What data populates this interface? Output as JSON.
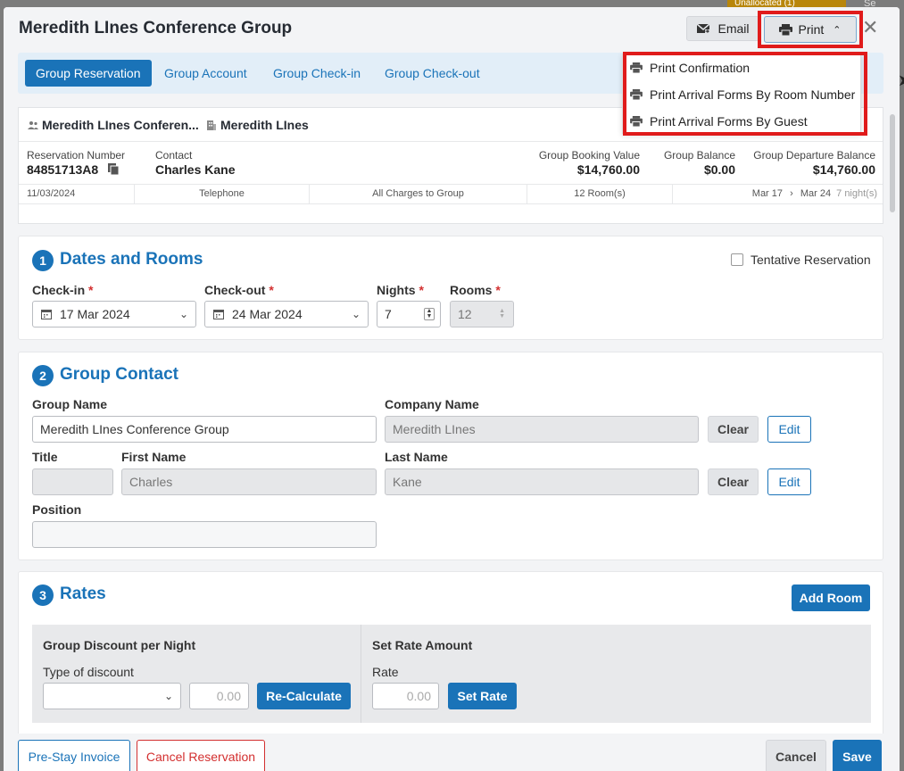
{
  "background": {
    "unallocated_label": "Unallocated (1)",
    "search_label": "Se"
  },
  "colors": {
    "brand_blue": "#1a73b8",
    "highlight_red": "#e01b1b",
    "required_red": "#d32f2f"
  },
  "modal": {
    "title": "Meredith LInes Conference Group",
    "email_label": "Email",
    "print_label": "Print",
    "close_icon": "close-icon"
  },
  "print_menu": {
    "items": [
      {
        "label": "Print Confirmation",
        "icon": "printer-icon"
      },
      {
        "label": "Print Arrival Forms By Room Number",
        "icon": "printer-icon"
      },
      {
        "label": "Print Arrival Forms By Guest",
        "icon": "printer-icon"
      }
    ]
  },
  "tabs": [
    {
      "label": "Group Reservation",
      "active": true
    },
    {
      "label": "Group Account",
      "active": false
    },
    {
      "label": "Group Check-in",
      "active": false
    },
    {
      "label": "Group Check-out",
      "active": false
    }
  ],
  "summary": {
    "group_name": "Meredith LInes Conferen...",
    "company_name": "Meredith LInes",
    "reservation_number_label": "Reservation Number",
    "reservation_number": "84851713A8",
    "contact_label": "Contact",
    "contact": "Charles Kane",
    "booking_value_label": "Group Booking Value",
    "booking_value": "$14,760.00",
    "balance_label": "Group Balance",
    "balance": "$0.00",
    "departure_balance_label": "Group Departure Balance",
    "departure_balance": "$14,760.00",
    "strip": {
      "date": "11/03/2024",
      "channel": "Telephone",
      "charges": "All Charges to Group",
      "rooms": "12 Room(s)",
      "arrive": "Mar 17",
      "arrow": "›",
      "depart": "Mar 24",
      "nights": "7 night(s)"
    }
  },
  "dates_rooms": {
    "number": "1",
    "title": "Dates and Rooms",
    "tentative_label": "Tentative Reservation",
    "tentative_checked": false,
    "checkin_label": "Check-in",
    "checkin_value": "17 Mar 2024",
    "checkout_label": "Check-out",
    "checkout_value": "24 Mar 2024",
    "nights_label": "Nights",
    "nights_value": "7",
    "rooms_label": "Rooms",
    "rooms_value": "12",
    "required_mark": "*"
  },
  "group_contact": {
    "number": "2",
    "title": "Group Contact",
    "group_name_label": "Group Name",
    "group_name_value": "Meredith LInes Conference Group",
    "company_name_label": "Company Name",
    "company_name_value": "Meredith LInes",
    "title_label": "Title",
    "title_value": "",
    "first_name_label": "First Name",
    "first_name_value": "Charles",
    "last_name_label": "Last Name",
    "last_name_value": "Kane",
    "position_label": "Position",
    "position_value": "",
    "clear_label": "Clear",
    "edit_label": "Edit"
  },
  "rates": {
    "number": "3",
    "title": "Rates",
    "add_room_label": "Add Room",
    "discount_heading": "Group Discount per Night",
    "type_label": "Type of discount",
    "type_value": "",
    "discount_amount": "0.00",
    "recalculate_label": "Re-Calculate",
    "set_rate_heading": "Set Rate Amount",
    "rate_label": "Rate",
    "rate_amount": "0.00",
    "set_rate_label": "Set Rate"
  },
  "footer": {
    "pre_stay_label": "Pre-Stay Invoice",
    "cancel_res_label": "Cancel Reservation",
    "cancel_label": "Cancel",
    "save_label": "Save"
  }
}
